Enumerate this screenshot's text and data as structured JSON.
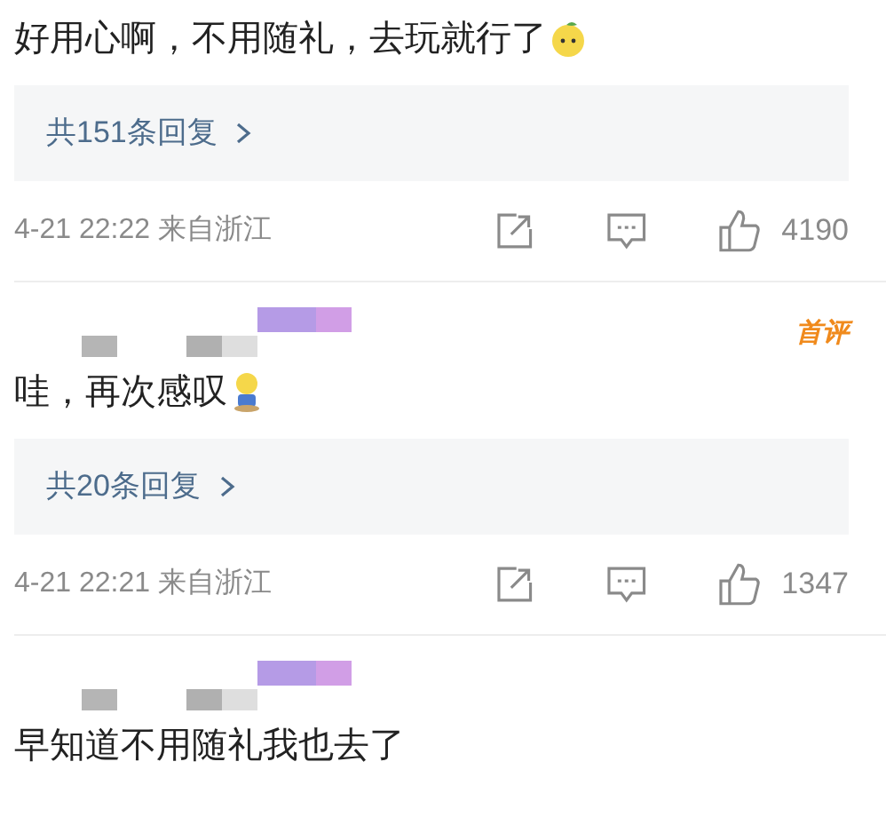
{
  "comments": [
    {
      "text": "好用心啊，不用随礼，去玩就行了",
      "emoji": {
        "kind": "face"
      },
      "replies": "共151条回复",
      "time": "4-21 22:22 来自浙江",
      "likes": "4190"
    },
    {
      "author": {
        "kind": "pixelated"
      },
      "badge": "首评",
      "text": "哇，再次感叹",
      "emoji": {
        "kind": "figure"
      },
      "replies": "共20条回复",
      "time": "4-21 22:21 来自浙江",
      "likes": "1347"
    },
    {
      "author": {
        "kind": "pixelated"
      },
      "text": "早知道不用随礼我也去了"
    }
  ]
}
